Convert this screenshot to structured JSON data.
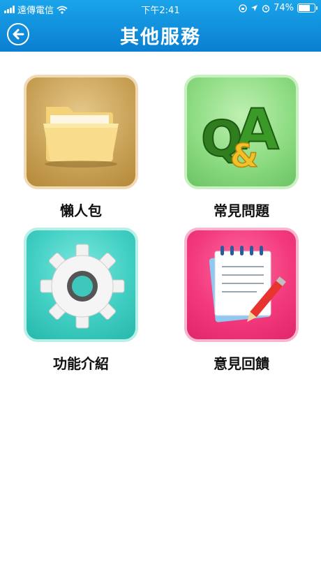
{
  "status_bar": {
    "carrier": "遠傳電信",
    "time": "下午2:41",
    "battery": "74%",
    "battery_level": 0.74
  },
  "header": {
    "title": "其他服務",
    "back_icon": "back-arrow-icon"
  },
  "tiles": [
    {
      "label": "懶人包",
      "icon": "folder-icon",
      "color": "#caa45a"
    },
    {
      "label": "常見問題",
      "icon": "qa-icon",
      "color": "#8edc83",
      "icon_text": "Q&A"
    },
    {
      "label": "功能介紹",
      "icon": "gear-icon",
      "color": "#41cfc3"
    },
    {
      "label": "意見回饋",
      "icon": "notepad-pencil-icon",
      "color": "#f23a7c"
    }
  ]
}
